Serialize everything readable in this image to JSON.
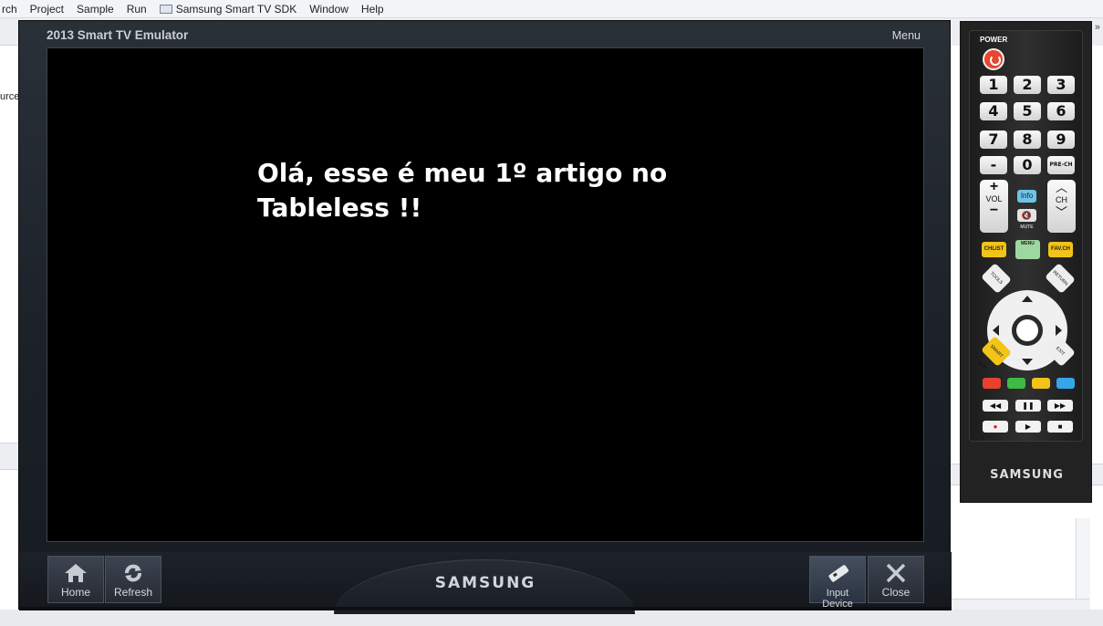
{
  "menubar": {
    "items": [
      "rch",
      "Project",
      "Sample",
      "Run",
      "Samsung Smart TV SDK",
      "Window",
      "Help"
    ]
  },
  "ide": {
    "left_fragment": "urce",
    "right_chevron": "»"
  },
  "emulator": {
    "title": "2013 Smart TV Emulator",
    "menu_label": "Menu",
    "screen_text": "Olá, esse é meu 1º artigo no Tableless !!",
    "brand": "SAMSUNG",
    "buttons": {
      "home": "Home",
      "refresh": "Refresh",
      "input_device": "Input Device",
      "close": "Close"
    }
  },
  "remote": {
    "power_label": "POWER",
    "digits": [
      "1",
      "2",
      "3",
      "4",
      "5",
      "6",
      "7",
      "8",
      "9",
      "-",
      "0"
    ],
    "prech": "PRE-CH",
    "vol_label": "VOL",
    "ch_label": "CH",
    "info": "Info",
    "mute": "MUTE",
    "chlist": "CHLIST",
    "menu": "MENU",
    "favch": "FAV.CH",
    "tools": "TOOLS",
    "return": "RETURN",
    "smarthub": "SMART HUB",
    "exit": "EXIT",
    "brand": "SAMSUNG",
    "colors": [
      "#e8412e",
      "#3dbb45",
      "#f2c318",
      "#35a6e8"
    ]
  }
}
